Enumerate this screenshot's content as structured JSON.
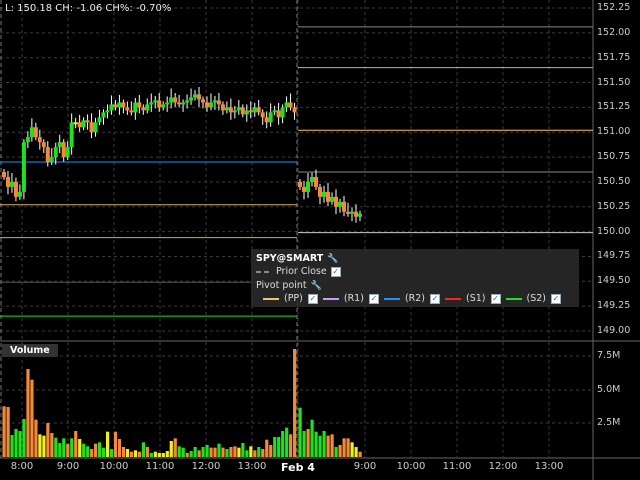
{
  "info_bar": "L: 150.18 CH: -1.06 CH%: -0.70%",
  "volume_label": "Volume",
  "legend": {
    "symbol": "SPY@SMART",
    "prior_close": "Prior Close",
    "pivot_title": "Pivot point",
    "items": [
      {
        "label": "(PP)",
        "color": "#f5c26b"
      },
      {
        "label": "(R1)",
        "color": "#c79cf0"
      },
      {
        "label": "(R2)",
        "color": "#1e90ff"
      },
      {
        "label": "(S1)",
        "color": "#ff2020"
      },
      {
        "label": "(S2)",
        "color": "#20e020"
      }
    ]
  },
  "price_axis": [
    "152.25",
    "152.00",
    "151.75",
    "151.50",
    "151.25",
    "151.00",
    "150.75",
    "150.50",
    "150.25",
    "150.00",
    "149.75",
    "149.50",
    "149.25",
    "149.00"
  ],
  "volume_axis": [
    "7.5M",
    "5.0M",
    "2.5M"
  ],
  "time_axis": [
    {
      "label": "8:00"
    },
    {
      "label": "9:00"
    },
    {
      "label": "10:00"
    },
    {
      "label": "11:00"
    },
    {
      "label": "12:00"
    },
    {
      "label": "13:00"
    },
    {
      "label": "Feb 4",
      "bold": true
    },
    {
      "label": "9:00"
    },
    {
      "label": "10:00"
    },
    {
      "label": "11:00"
    },
    {
      "label": "12:00"
    },
    {
      "label": "13:00"
    }
  ],
  "chart_data": {
    "type": "candlestick",
    "ylim": [
      149.0,
      152.25
    ],
    "volume_ylim": [
      0,
      8.5
    ],
    "colors": {
      "up": "#20e020",
      "down": "#f5893a",
      "flat": "#f0f020"
    },
    "pivot_lines": [
      {
        "day": 1,
        "price": 150.7,
        "color": "#1e90ff"
      },
      {
        "day": 1,
        "price": 150.27,
        "color": "#d8b070"
      },
      {
        "day": 1,
        "price": 149.94,
        "color": "#f5a030"
      },
      {
        "day": 1,
        "price": 149.49,
        "color": "#555555"
      },
      {
        "day": 1,
        "price": 149.15,
        "color": "#20e020"
      },
      {
        "day": 2,
        "price": 152.06,
        "color": "#888888"
      },
      {
        "day": 2,
        "price": 151.65,
        "color": "#c79cf0"
      },
      {
        "day": 2,
        "price": 151.02,
        "color": "#f5c26b"
      },
      {
        "day": 2,
        "price": 150.6,
        "color": "#888888"
      },
      {
        "day": 2,
        "price": 149.99,
        "color": "#cccccc"
      }
    ],
    "day1_closes": [
      150.55,
      150.45,
      150.5,
      150.35,
      150.4,
      150.9,
      150.95,
      151.05,
      150.95,
      150.9,
      150.85,
      150.7,
      150.75,
      150.85,
      150.9,
      150.75,
      150.85,
      151.1,
      151.1,
      151.05,
      151.12,
      151.1,
      151.0,
      151.1,
      151.15,
      151.2,
      151.22,
      151.28,
      151.25,
      151.3,
      151.25,
      151.22,
      151.2,
      151.3,
      151.25,
      151.22,
      151.28,
      151.3,
      151.32,
      151.25,
      151.28,
      151.3,
      151.35,
      151.3,
      151.28,
      151.3,
      151.32,
      151.35,
      151.38,
      151.33,
      151.3,
      151.25,
      151.3,
      151.32,
      151.28,
      151.22,
      151.25,
      151.2,
      151.22,
      151.25,
      151.18,
      151.22,
      151.2,
      151.25,
      151.2,
      151.15,
      151.1,
      151.2,
      151.22,
      151.15,
      151.25,
      151.3,
      151.25,
      151.2
    ],
    "day2_closes": [
      150.45,
      150.4,
      150.5,
      150.55,
      150.45,
      150.35,
      150.4,
      150.3,
      150.35,
      150.25,
      150.3,
      150.2,
      150.18,
      150.2,
      150.15,
      150.18
    ],
    "day1_volume_m": [
      3.8,
      3.75,
      1.65,
      2.1,
      1.95,
      2.85,
      6.6,
      5.8,
      2.8,
      1.7,
      1.6,
      2.55,
      1.8,
      1.45,
      1.05,
      1.4,
      1.0,
      1.4,
      1.95,
      1.35,
      1.0,
      0.8,
      0.6,
      1.0,
      1.1,
      0.7,
      1.9,
      0.6,
      1.9,
      1.35,
      0.75,
      0.6,
      0.4,
      0.5,
      0.4,
      1.1,
      0.75,
      0.3,
      0.4,
      0.3,
      0.3,
      0.45,
      1.2,
      1.4,
      0.8,
      0.7,
      0.3,
      0.45,
      0.75,
      0.5,
      0.75,
      0.9,
      0.7,
      0.7,
      1.0,
      0.7,
      0.6,
      0.75,
      0.8,
      0.7,
      1.05,
      0.5,
      0.8,
      0.5,
      0.75,
      0.6,
      1.3,
      0.9,
      1.5,
      1.5,
      1.95,
      2.2,
      1.7,
      8.1
    ],
    "day1_volume_colors": "ooggggoooyyoogggogoyggooggygoooyoyogogyyyyyoggoggoggoogogooyggyogoooggggoo",
    "day2_volume_m": [
      3.7,
      1.95,
      2.1,
      2.8,
      1.9,
      1.6,
      1.95,
      1.6,
      1.7,
      0.75,
      0.9,
      1.4,
      1.4,
      1.1,
      0.75,
      0.4
    ],
    "day2_volume_colors": "ggoggggoogoooyyo"
  }
}
